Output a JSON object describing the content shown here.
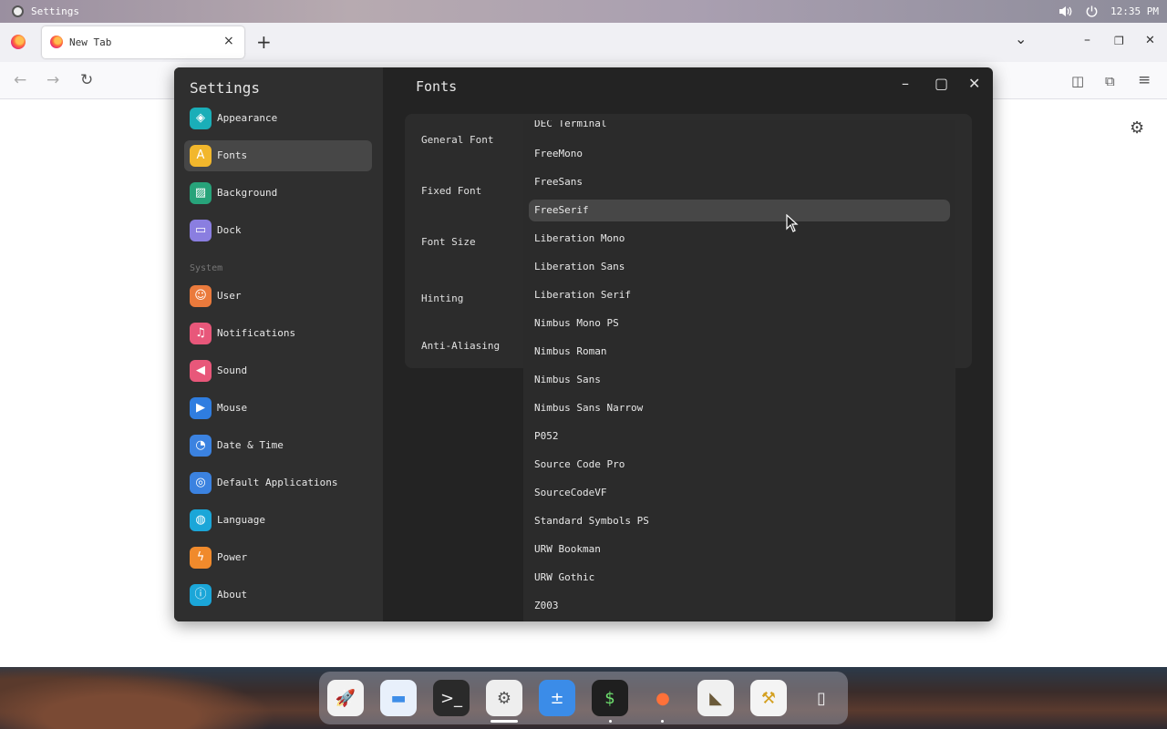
{
  "topbar": {
    "app_title": "Settings",
    "icons": [
      "settings-app-icon",
      "volume-icon",
      "power-icon"
    ],
    "clock": "12:35 PM"
  },
  "browser": {
    "tab_title": "New Tab",
    "tab_close": "×",
    "new_tab": "+",
    "list_all_tabs": "⌄",
    "minimize": "–",
    "restore": "❐",
    "close": "✕",
    "back": "←",
    "forward": "→",
    "reload": "↻",
    "pocket": "◫",
    "extensions": "⧉",
    "menu": "≡",
    "page_settings": "⚙"
  },
  "settings": {
    "title": "Settings",
    "sidebar": {
      "personal": [
        {
          "label": "Appearance",
          "icon": "appearance-icon",
          "glyph": "◈",
          "color": "#1aaeb8"
        },
        {
          "label": "Fonts",
          "icon": "fonts-icon",
          "glyph": "A",
          "color": "#f2b72c",
          "active": true
        },
        {
          "label": "Background",
          "icon": "background-icon",
          "glyph": "▨",
          "color": "#27a37a"
        },
        {
          "label": "Dock",
          "icon": "dock-icon",
          "glyph": "▭",
          "color": "#8a7ee0"
        }
      ],
      "section": "System",
      "system": [
        {
          "label": "User",
          "icon": "user-icon",
          "glyph": "☺",
          "color": "#ea7a3c"
        },
        {
          "label": "Notifications",
          "icon": "notifications-icon",
          "glyph": "♫",
          "color": "#e8577a"
        },
        {
          "label": "Sound",
          "icon": "sound-icon",
          "glyph": "◀",
          "color": "#e8577a"
        },
        {
          "label": "Mouse",
          "icon": "mouse-icon",
          "glyph": "▶",
          "color": "#2f7de0"
        },
        {
          "label": "Date & Time",
          "icon": "clock-icon",
          "glyph": "◔",
          "color": "#3b82e0"
        },
        {
          "label": "Default Applications",
          "icon": "default-apps-icon",
          "glyph": "◎",
          "color": "#3b82e0"
        },
        {
          "label": "Language",
          "icon": "globe-icon",
          "glyph": "◍",
          "color": "#1ba6d8"
        },
        {
          "label": "Power",
          "icon": "power-bolt-icon",
          "glyph": "ϟ",
          "color": "#f08a2c"
        },
        {
          "label": "About",
          "icon": "info-icon",
          "glyph": "ⓘ",
          "color": "#1ba6d8"
        }
      ]
    },
    "page_title": "Fonts",
    "window_controls": {
      "minimize": "–",
      "maximize": "▢",
      "close": "✕"
    },
    "rows": [
      "General Font",
      "Fixed Font",
      "Font Size",
      "Hinting",
      "Anti-Aliasing"
    ],
    "font_dropdown": {
      "partial_top": "DEC Terminal",
      "items": [
        "FreeMono",
        "FreeSans",
        "FreeSerif",
        "Liberation Mono",
        "Liberation Sans",
        "Liberation Serif",
        "Nimbus Mono PS",
        "Nimbus Roman",
        "Nimbus Sans",
        "Nimbus Sans Narrow",
        "P052",
        "Source Code Pro",
        "SourceCodeVF",
        "Standard Symbols PS",
        "URW Bookman",
        "URW Gothic",
        "Z003"
      ],
      "highlighted": "FreeSerif"
    }
  },
  "dock": {
    "apps": [
      {
        "name": "launcher",
        "glyph": "🚀",
        "bg": "#f2f2f2",
        "fg": "#333"
      },
      {
        "name": "files",
        "glyph": "▬",
        "bg": "#e8f0fb",
        "fg": "#3d8de8"
      },
      {
        "name": "terminal",
        "glyph": ">_",
        "bg": "#2a2a2a",
        "fg": "#eee"
      },
      {
        "name": "settings",
        "glyph": "⚙",
        "bg": "#eeeeee",
        "fg": "#555"
      },
      {
        "name": "calculator",
        "glyph": "±",
        "bg": "#3b8ce8",
        "fg": "#fff"
      },
      {
        "name": "system-monitor",
        "glyph": "$",
        "bg": "#1f1f1f",
        "fg": "#6ee06e"
      },
      {
        "name": "firefox",
        "glyph": "●",
        "bg": "transparent",
        "fg": "#ff7139"
      },
      {
        "name": "gimp",
        "glyph": "◣",
        "bg": "#f0f0f0",
        "fg": "#6b5a3a"
      },
      {
        "name": "software-center",
        "glyph": "⚒",
        "bg": "#f4f4f4",
        "fg": "#d4a020"
      },
      {
        "name": "trash",
        "glyph": "▯",
        "bg": "transparent",
        "fg": "#eee"
      }
    ]
  }
}
